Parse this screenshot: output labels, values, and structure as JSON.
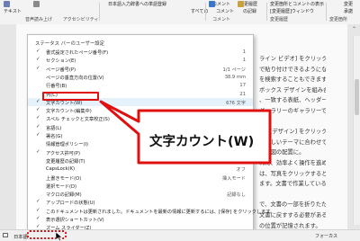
{
  "ribbon": {
    "row1": [
      "日本語入力辞書への単語登録",
      "コメント",
      "変更履歴",
      "変更箇所とコメントの表示",
      "変更"
    ],
    "row2": [
      "テキスト",
      "すべての",
      "コメント",
      "の記録",
      "[変更履歴]ウィンドウ",
      "承諾"
    ],
    "row3": [
      "音声読み上げ",
      "アクセシビリティ",
      "コメント",
      "変更履歴",
      "変更箇所"
    ]
  },
  "menu": {
    "title": "ステータス バーのユーザー設定",
    "items": [
      {
        "checked": true,
        "label": "書式設定されたページ番号(F)",
        "value": "1"
      },
      {
        "checked": true,
        "label": "セクション(E)",
        "value": "1"
      },
      {
        "checked": true,
        "label": "ページ番号(P)",
        "value": "1/1 ページ"
      },
      {
        "checked": false,
        "label": "ページの垂直方向の位置(V)",
        "value": "38.9 mm"
      },
      {
        "checked": false,
        "label": "行番号(B)",
        "value": "17"
      },
      {
        "checked": false,
        "label": "列(C)",
        "value": "21"
      },
      {
        "checked": true,
        "label": "文字カウント(W)",
        "value": "676 文字"
      },
      {
        "checked": true,
        "label": "文字カウント(編集中)",
        "value": ""
      },
      {
        "checked": true,
        "label": "スペル チェックと文章校正(S)",
        "value": "エラーなし"
      },
      {
        "checked": true,
        "label": "言語(L)",
        "value": "日本語"
      },
      {
        "checked": true,
        "label": "署名(G)",
        "value": "オフ"
      },
      {
        "checked": false,
        "label": "情報管理ポリシー(I)",
        "value": "オフ"
      },
      {
        "checked": true,
        "label": "アクセス許可(P)",
        "value": "オフ"
      },
      {
        "checked": false,
        "label": "変更履歴の記録(T)",
        "value": "オフ"
      },
      {
        "checked": false,
        "label": "CapsLock(K)",
        "value": "オフ"
      },
      {
        "checked": false,
        "label": "上書きモード(O)",
        "value": "挿入モード"
      },
      {
        "checked": false,
        "label": "選択モード(D)",
        "value": ""
      },
      {
        "checked": false,
        "label": "マクロの記録(M)",
        "value": "記録なし"
      },
      {
        "checked": true,
        "label": "アップロードの状態(U)",
        "value": ""
      },
      {
        "checked": true,
        "label": "このドキュメントは更新されました。ドキュメントを最新の情報に更新するには、[保存] をクリックします。",
        "value": ""
      },
      {
        "checked": true,
        "label": "表示選択ショートカット(V)",
        "value": ""
      },
      {
        "checked": true,
        "label": "ズーム スライダー(Z)",
        "value": ""
      },
      {
        "checked": true,
        "label": "ズーム(Z)",
        "value": "100%"
      }
    ]
  },
  "callout": {
    "text": "文字カウント(W)"
  },
  "document": {
    "lines": [
      "ライン ビデオ] をクリックする",
      "で貼り付けできるようになりま",
      "を検索することもできます。",
      "ボックス デザインを組み合わ",
      "、一致する表紙、ヘッダー、",
      "ギャラリーのギャラリーで目的の要",
      "",
      "す。[デザイン] をクリック",
      "が新しいテーマに合わせて変わ",
      "トと図の配置に。",
      "れた、効率よく操作を進める",
      "は、写真をクリックすると、",
      "ます。文書で作業していると",
      "",
      "で、文書の一部を折りたたんで、",
      "文書に戻すする必要がある場合、",
      "の位置が記憶されます。"
    ]
  },
  "statusbar": {
    "language": "日本語",
    "focus": "フォーカス"
  },
  "colors": {
    "accent": "#e01010",
    "menu_bg": "#ffffff",
    "ribbon_bg": "#f3f3f3"
  }
}
